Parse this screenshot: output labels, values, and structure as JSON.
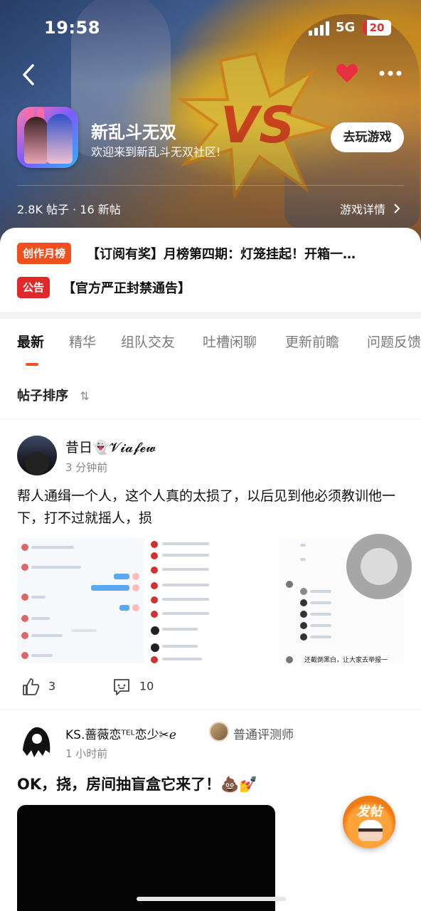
{
  "status_bar": {
    "time": "19:58",
    "network": "5G",
    "battery": "20"
  },
  "header": {
    "game_name": "新乱斗无双",
    "welcome": "欢迎来到新乱斗无双社区!",
    "play_button": "去玩游戏",
    "stats": "2.8K 帖子 · 16 新帖",
    "details_link": "游戏详情"
  },
  "notices": [
    {
      "badge": "创作月榜",
      "text": "【订阅有奖】月榜第四期：灯笼挂起！开箱一…",
      "badge_color": "#f0501e"
    },
    {
      "badge": "公告",
      "text": "【官方严正封禁通告】",
      "badge_color": "#e0282b"
    }
  ],
  "tabs": [
    "最新",
    "精华",
    "组队交友",
    "吐槽闲聊",
    "更新前瞻",
    "问题反馈"
  ],
  "active_tab": "最新",
  "sort_label": "帖子排序",
  "sort_icon": "⇅",
  "posts": [
    {
      "user": "昔日👻𝓥𝓲𝓪𝓯𝓮𝔀",
      "time": "3 分钟前",
      "text": "帮人通缉一个人，这个人真的太损了，以后见到他必须教训他一下，打不过就摇人，损",
      "likes": "3",
      "comments": "10",
      "image_caption": "还截倒黑白，让大家去举报一"
    },
    {
      "user": "KS.蔷薇恋ᵀᴱᴸ恋少✂︎ℯ",
      "role": "普通评测师",
      "time": "1 小时前",
      "text": "OK，挠，房间抽盲盒它来了！💩💅"
    }
  ],
  "fab_label": "发帖",
  "colors": {
    "accent": "#f0501e",
    "notice_red": "#e0282b",
    "fav": "#e83040"
  }
}
